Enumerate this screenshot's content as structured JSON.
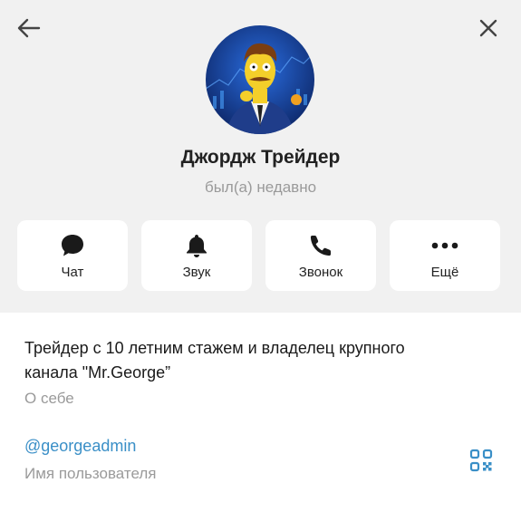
{
  "profile": {
    "name": "Джордж Трейдер",
    "status": "был(а) недавно"
  },
  "actions": [
    {
      "label": "Чат",
      "icon": "chat-bubble-icon"
    },
    {
      "label": "Звук",
      "icon": "bell-icon"
    },
    {
      "label": "Звонок",
      "icon": "phone-icon"
    },
    {
      "label": "Ещё",
      "icon": "more-dots-icon"
    }
  ],
  "info": {
    "bio_line1": "Трейдер с 10 летним стажем и владелец крупного",
    "bio_line2": "канала \"Mr.George”",
    "bio_label": "О себе",
    "username": "@georgeadmin",
    "username_label": "Имя пользователя"
  },
  "colors": {
    "header_bg": "#f1f1f1",
    "link": "#3a8fc7",
    "secondary_text": "#9a9a9a",
    "qr_icon": "#3a8fc7"
  }
}
